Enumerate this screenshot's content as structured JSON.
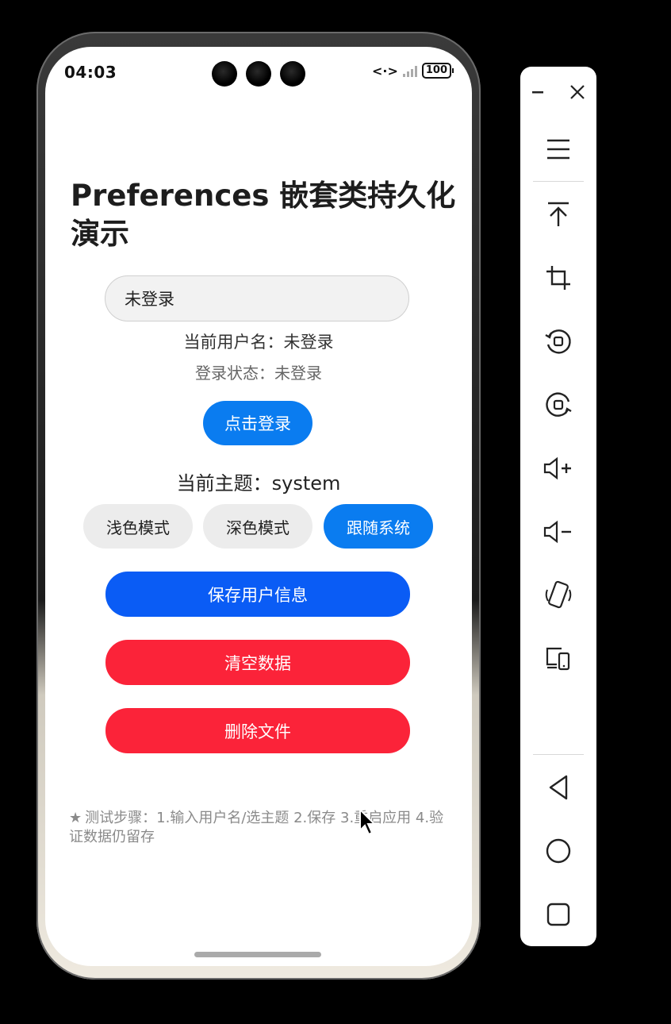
{
  "status_bar": {
    "time": "04:03",
    "battery": "100"
  },
  "app": {
    "title": "Preferences 嵌套类持久化演示",
    "username_input": {
      "value": "未登录",
      "placeholder": "未登录"
    },
    "current_user_text": "当前用户名：未登录",
    "login_status_text": "登录状态：未登录",
    "login_button": "点击登录",
    "current_theme_text": "当前主题：system",
    "theme_buttons": {
      "light": "浅色模式",
      "dark": "深色模式",
      "system": "跟随系统",
      "selected": "system"
    },
    "save_button": "保存用户信息",
    "clear_button": "清空数据",
    "delete_button": "删除文件",
    "tip": "测试步骤：1.输入用户名/选主题 2.保存 3.重启应用 4.验证数据仍留存"
  },
  "colors": {
    "primary_blue": "#0a7cf0",
    "save_blue": "#0a5cf5",
    "danger_red": "#fb2339"
  },
  "toolbar": {
    "items": [
      "minimize-icon",
      "close-icon",
      "menu-icon",
      "pin-top-icon",
      "crop-icon",
      "rotate-left-icon",
      "rotate-right-icon",
      "volume-up-icon",
      "volume-down-icon",
      "shake-icon",
      "multi-device-icon",
      "back-icon",
      "home-icon",
      "recents-icon"
    ]
  }
}
